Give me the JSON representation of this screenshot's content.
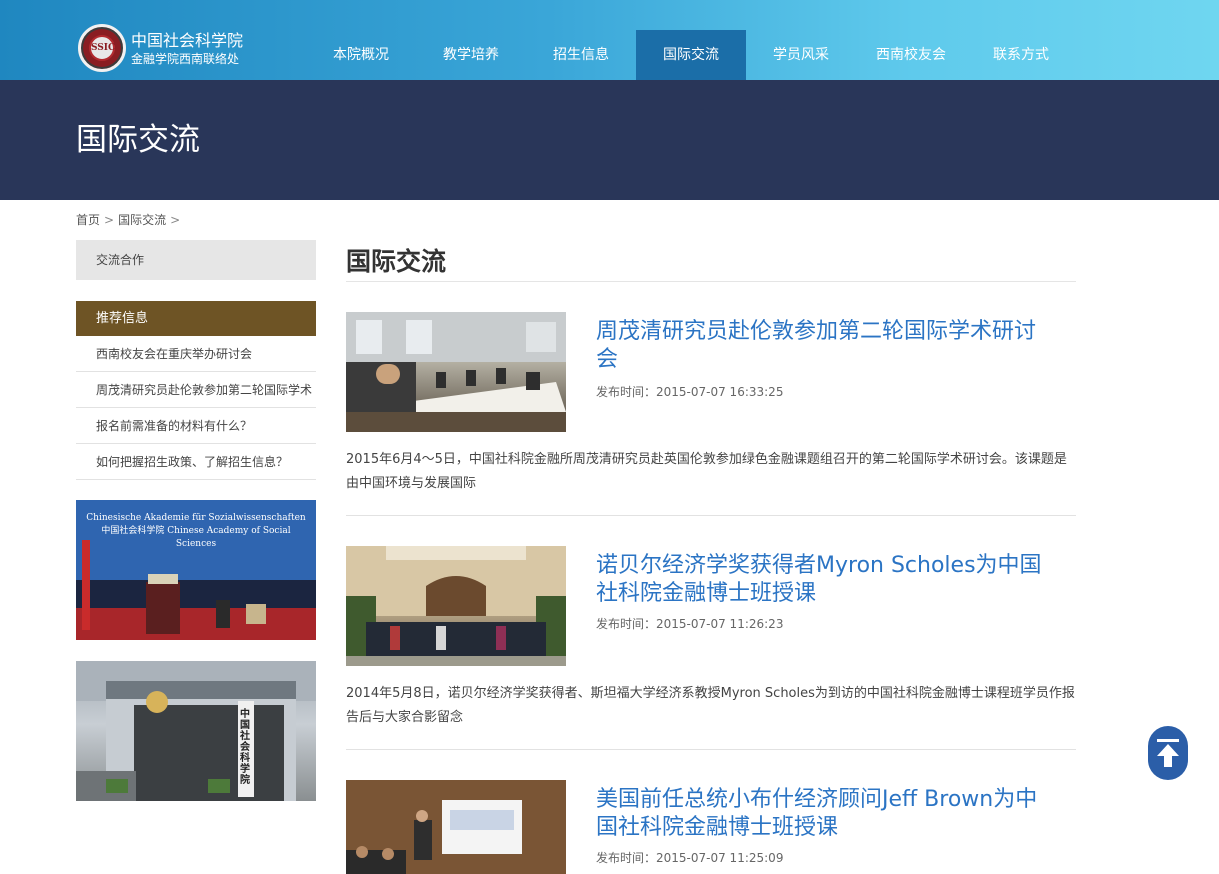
{
  "header": {
    "logo_text": "SSIC",
    "site_title": "中国社会科学院",
    "site_subtitle": "金融学院西南联络处",
    "nav": [
      {
        "label": "本院概况"
      },
      {
        "label": "教学培养"
      },
      {
        "label": "招生信息"
      },
      {
        "label": "国际交流",
        "active": true
      },
      {
        "label": "学员风采"
      },
      {
        "label": "西南校友会"
      },
      {
        "label": "联系方式"
      }
    ]
  },
  "banner": {
    "title": "国际交流"
  },
  "breadcrumb": {
    "home": "首页",
    "current": "国际交流",
    "sep": ">"
  },
  "sidebar": {
    "category": "交流合作",
    "recommend_title": "推荐信息",
    "recommend_items": [
      "西南校友会在重庆举办研讨会",
      "周茂清研究员赴伦敦参加第二轮国际学术",
      "报名前需准备的材料有什么？",
      "如何把握招生政策、了解招生信息？"
    ],
    "image1_caption": "Chinesische Akademie für Sozialwissenschaften 中国社会科学院 Chinese Academy of Social Sciences",
    "image2_caption": "中国社会科学院"
  },
  "content": {
    "title": "国际交流",
    "articles": [
      {
        "title": "周茂清研究员赴伦敦参加第二轮国际学术研讨会",
        "date": "发布时间：2015-07-07 16:33:25",
        "summary": "2015年6月4～5日，中国社科院金融所周茂清研究员赴英国伦敦参加绿色金融课题组召开的第二轮国际学术研讨会。该课题是由中国环境与发展国际"
      },
      {
        "title": "诺贝尔经济学奖获得者Myron Scholes为中国社科院金融博士班授课",
        "date": "发布时间：2015-07-07 11:26:23",
        "summary": "2014年5月8日，诺贝尔经济学奖获得者、斯坦福大学经济系教授Myron Scholes为到访的中国社科院金融博士课程班学员作报告后与大家合影留念"
      },
      {
        "title": "美国前任总统小布什经济顾问Jeff Brown为中国社科院金融博士班授课",
        "date": "发布时间：2015-07-07 11:25:09",
        "summary": ""
      }
    ]
  },
  "colors": {
    "header_start": "#1f87c0",
    "header_end": "#6fd6f0",
    "nav_active": "#1b6ea8",
    "banner": "#293659",
    "recommend_head": "#6e5425",
    "link": "#2b74c4",
    "to_top": "#2b5ea8"
  },
  "icons": {
    "to_top": "arrow-up-to-top-icon"
  }
}
